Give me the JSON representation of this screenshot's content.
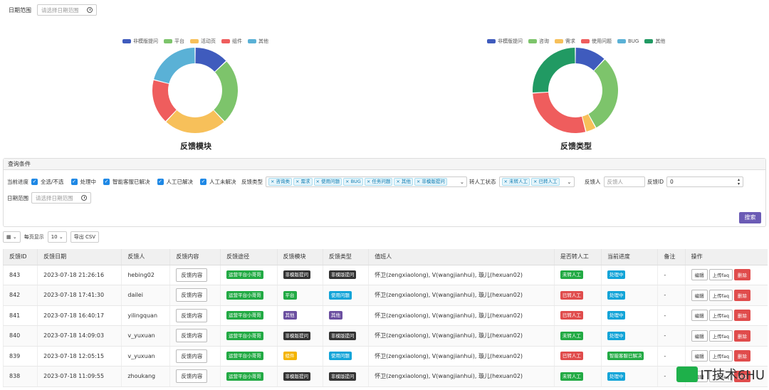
{
  "top_filter": {
    "label": "日期范围",
    "placeholder": "请选择日期范围"
  },
  "chart_data": [
    {
      "type": "pie",
      "title": "反馈模块",
      "categories": [
        "非模版提问",
        "平台",
        "活动页",
        "组件",
        "其他"
      ],
      "values": [
        13,
        25,
        24,
        17,
        21
      ],
      "colors": [
        "#3f5bbd",
        "#7dc46b",
        "#f7c05a",
        "#ef5d5d",
        "#5ab1d6"
      ]
    },
    {
      "type": "pie",
      "title": "反馈类型",
      "categories": [
        "非模版提问",
        "咨询",
        "需求",
        "使用问题",
        "BUG",
        "其他"
      ],
      "values": [
        12,
        30,
        4,
        28,
        0,
        26
      ],
      "colors": [
        "#3f5bbd",
        "#7dc46b",
        "#f7c05a",
        "#ef5d5d",
        "#5ab1d6",
        "#219a63"
      ]
    }
  ],
  "query": {
    "panel_title": "查询条件",
    "progress_label": "当前进度",
    "checks": [
      "全选/不选",
      "处理中",
      "智能客服已解决",
      "人工已解决",
      "人工未解决"
    ],
    "type_label": "反馈类型",
    "type_chips": [
      "咨询类",
      "需求",
      "使用问题",
      "BUG",
      "任务问题",
      "其他",
      "非模版提问"
    ],
    "manual_label": "转人工状态",
    "manual_chips": [
      "未转人工",
      "已转人工"
    ],
    "person_label": "反馈人",
    "person_placeholder": "反馈人",
    "id_label": "反馈ID",
    "id_value": "0",
    "date_label": "日期范围",
    "date_placeholder": "请选择日期范围",
    "search_btn": "搜索"
  },
  "toolbar": {
    "per_page_label": "每页显示",
    "per_page": "10",
    "export": "导出 CSV"
  },
  "table": {
    "headers": [
      "反馈ID",
      "反馈日期",
      "反馈人",
      "反馈内容",
      "反馈途径",
      "反馈模块",
      "反馈类型",
      "值班人",
      "是否转人工",
      "当前进度",
      "备注",
      "操作"
    ],
    "content_btn": "反馈内容",
    "edit": "编辑",
    "upload": "上传faq",
    "delete": "删除",
    "rows": [
      {
        "id": "843",
        "date": "2023-07-18 21:26:16",
        "user": "hebing02",
        "channel": "运营平台小哥哥",
        "module": "非模版提问",
        "mcls": "dk",
        "type": "非模版提问",
        "tcls": "dk",
        "duty": "怀卫(zengxiaolong), V(wangjianhui), 璇儿(hexuan02)",
        "manual": "未转人工",
        "mncls": "g",
        "progress": "处理中",
        "pcls": "cy",
        "note": "-"
      },
      {
        "id": "842",
        "date": "2023-07-18 17:41:30",
        "user": "dailei",
        "channel": "运营平台小哥哥",
        "module": "平台",
        "mcls": "g",
        "type": "使用问题",
        "tcls": "cy",
        "duty": "怀卫(zengxiaolong), V(wangjianhui), 璇儿(hexuan02)",
        "manual": "已转人工",
        "mncls": "rd",
        "progress": "处理中",
        "pcls": "cy",
        "note": "-"
      },
      {
        "id": "841",
        "date": "2023-07-18 16:40:17",
        "user": "yilingquan",
        "channel": "运营平台小哥哥",
        "module": "其他",
        "mcls": "pu",
        "type": "其他",
        "tcls": "pu",
        "duty": "怀卫(zengxiaolong), V(wangjianhui), 璇儿(hexuan02)",
        "manual": "已转人工",
        "mncls": "rd",
        "progress": "处理中",
        "pcls": "cy",
        "note": "-"
      },
      {
        "id": "840",
        "date": "2023-07-18 14:09:03",
        "user": "v_yuxuan",
        "channel": "运营平台小哥哥",
        "module": "非模版提问",
        "mcls": "dk",
        "type": "非模版提问",
        "tcls": "dk",
        "duty": "怀卫(zengxiaolong), V(wangjianhui), 璇儿(hexuan02)",
        "manual": "未转人工",
        "mncls": "g",
        "progress": "处理中",
        "pcls": "cy",
        "note": "-"
      },
      {
        "id": "839",
        "date": "2023-07-18 12:05:15",
        "user": "v_yuxuan",
        "channel": "运营平台小哥哥",
        "module": "组件",
        "mcls": "yl",
        "type": "使用问题",
        "tcls": "cy",
        "duty": "怀卫(zengxiaolong), V(wangjianhui), 璇儿(hexuan02)",
        "manual": "已转人工",
        "mncls": "rd",
        "progress": "智能客服已解决",
        "pcls": "g",
        "note": "-"
      },
      {
        "id": "838",
        "date": "2023-07-18 11:09:55",
        "user": "zhoukang",
        "channel": "运营平台小哥哥",
        "module": "非模版提问",
        "mcls": "dk",
        "type": "非模版提问",
        "tcls": "dk",
        "duty": "怀卫(zengxiaolong), V(wangjianhui), 璇儿(hexuan02)",
        "manual": "未转人工",
        "mncls": "g",
        "progress": "处理中",
        "pcls": "cy",
        "note": "-"
      }
    ]
  },
  "watermark": "IT技术6HU"
}
